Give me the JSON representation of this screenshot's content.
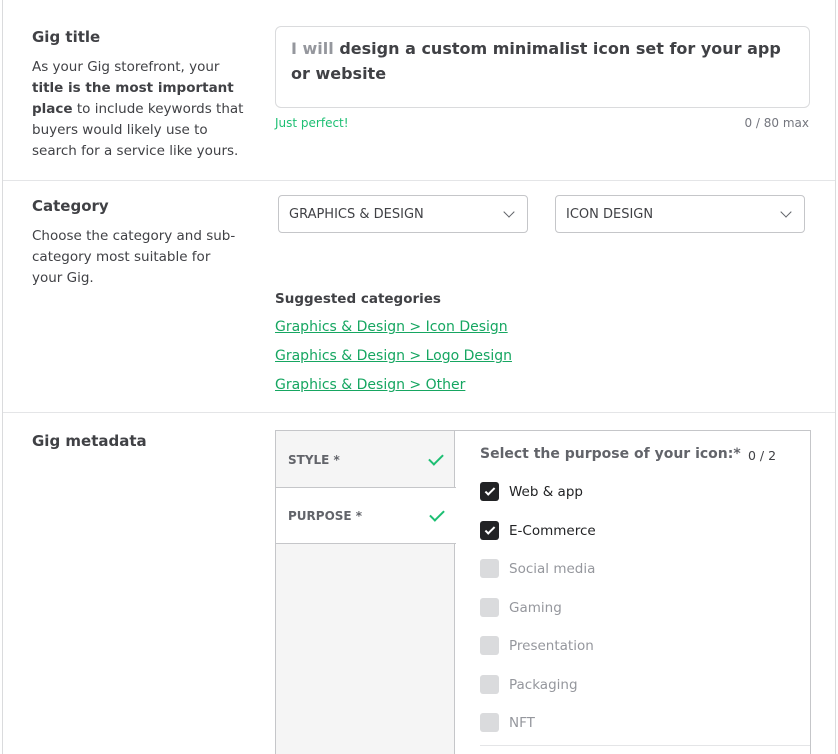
{
  "gig_title": {
    "heading": "Gig title",
    "desc_1": "As your Gig storefront, your ",
    "desc_bold": "title is the most important place",
    "desc_2": " to include keywords that buyers would likely use to search for a service like yours.",
    "prefix": "I will",
    "value": "design a custom minimalist icon set for your app or website",
    "hint": "Just perfect!",
    "counter": "0 / 80 max"
  },
  "category": {
    "heading": "Category",
    "desc": "Choose the category and sub-category most suitable for your Gig.",
    "category_value": "GRAPHICS & DESIGN",
    "subcategory_value": "ICON DESIGN",
    "suggested_title": "Suggested categories",
    "suggested": [
      "Graphics & Design > Icon Design",
      "Graphics & Design > Logo Design",
      "Graphics & Design > Other"
    ]
  },
  "metadata": {
    "heading": "Gig metadata",
    "tabs": [
      {
        "label": "STYLE *",
        "done": true
      },
      {
        "label": "PURPOSE *",
        "done": true
      }
    ],
    "question": "Select the purpose of your icon:*",
    "count": "0 / 2",
    "options": [
      {
        "label": "Web & app",
        "checked": true
      },
      {
        "label": "E-Commerce",
        "checked": true
      },
      {
        "label": "Social media",
        "checked": false
      },
      {
        "label": "Gaming",
        "checked": false
      },
      {
        "label": "Presentation",
        "checked": false
      },
      {
        "label": "Packaging",
        "checked": false
      },
      {
        "label": "NFT",
        "checked": false
      }
    ]
  },
  "colors": {
    "accent": "#1dbf73",
    "text": "#404145",
    "checkbox_on": "#222325",
    "checkbox_off": "#dadbdd"
  }
}
